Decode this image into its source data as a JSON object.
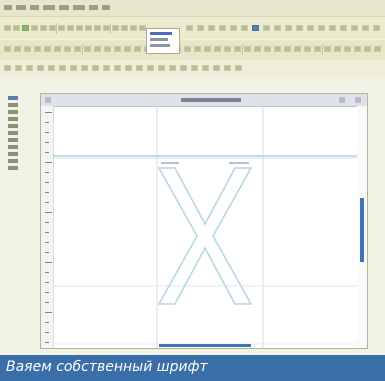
{
  "caption": "Ваяем собственный шрифт",
  "colors": {
    "accent": "#3a6ea8",
    "guide": "#9fc8d8",
    "glyph_outline": "#b7d6e2",
    "scroll_thumb": "#3f76b5"
  },
  "icons": {
    "menu": "menu-icon",
    "toolbar": "tool-icon",
    "window_close": "close-icon"
  }
}
